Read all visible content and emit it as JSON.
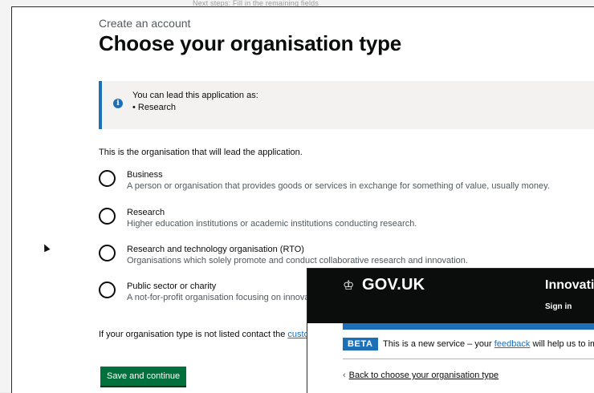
{
  "background_window": {
    "text": "Next steps: Fill in the remaining fields"
  },
  "page": {
    "caption": "Create an account",
    "heading": "Choose your organisation type",
    "inset": {
      "lead": "You can lead this application as:",
      "items": [
        "Research"
      ]
    },
    "intro": "This is the organisation that will lead the application.",
    "options": [
      {
        "label": "Business",
        "hint": "A person or organisation that provides goods or services in exchange for something of value, usually money."
      },
      {
        "label": "Research",
        "hint": "Higher education institutions or academic institutions conducting research."
      },
      {
        "label": "Research and technology organisation (RTO)",
        "hint": "Organisations which solely promote and conduct collaborative research and innovation."
      },
      {
        "label": "Public sector or charity",
        "hint": "A not-for-profit organisation focusing on innovation"
      }
    ],
    "note_prefix": "If your organisation type is not listed contact the ",
    "note_link": "customer support service",
    "primary_button": "Save and continue"
  },
  "overlay": {
    "logo": "GOV.UK",
    "service_name": "Innovation Funding Service",
    "sign_in": "Sign in",
    "phase_tag": "BETA",
    "phase_prefix": "This is a new service – your ",
    "phase_link": "feedback",
    "phase_suffix": " will help us to improve it.",
    "back_link": "Back to choose your organisation type"
  },
  "colors": {
    "link": "#1d70b8",
    "button": "#00703c",
    "header": "#0b0c0c",
    "inset_border": "#1d70b8"
  }
}
